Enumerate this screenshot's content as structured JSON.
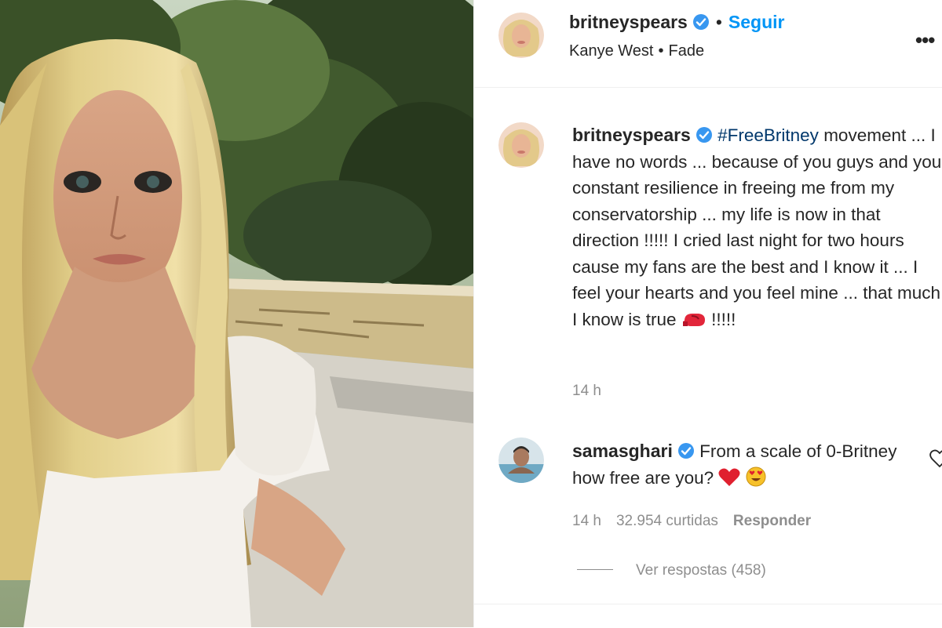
{
  "post": {
    "author": "britneyspears",
    "follow_label": "Seguir",
    "audio_artist": "Kanye West",
    "audio_song": "Fade",
    "more_icon": "more-options-icon"
  },
  "caption": {
    "author": "britneyspears",
    "hashtag": "#FreeBritney",
    "text": " movement ... I have no words ... because of you guys and your constant resilience in freeing me from my conservatorship ... my life is now in that direction !!!!! I cried last night for two hours cause my fans are the best and I know it ... I feel your hearts and you feel mine ... that much I know is true ",
    "emoji": "boxing-glove-emoji",
    "suffix": " !!!!!",
    "time": "14 h"
  },
  "comment": {
    "author": "samasghari",
    "text": " From a scale of 0-Britney how free are you? ",
    "time": "14 h",
    "likes": "32.954 curtidas",
    "reply_label": "Responder",
    "view_replies": "Ver respostas (458)"
  },
  "colors": {
    "link": "#0095f6",
    "hashtag": "#00376b",
    "verified": "#3897f0",
    "muted": "#8e8e8e"
  }
}
